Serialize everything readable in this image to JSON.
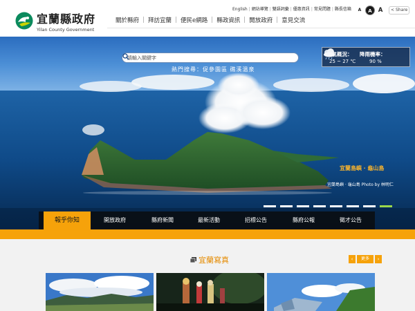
{
  "header": {
    "logo": {
      "name_cn": "宜蘭縣政府",
      "name_en": "Yilan County Government"
    },
    "utility_links": [
      {
        "label": "English"
      },
      {
        "label": "網站導覽"
      },
      {
        "label": "雙語詞彙"
      },
      {
        "label": "優惠資訊"
      },
      {
        "label": "常見問題"
      },
      {
        "label": "縣長信箱"
      }
    ],
    "font_sizes": [
      "A",
      "A",
      "A"
    ],
    "share_label": "Share",
    "main_nav": [
      {
        "label": "關於縣府"
      },
      {
        "label": "拜訪宜蘭"
      },
      {
        "label": "便民e網路"
      },
      {
        "label": "縣政資訊"
      },
      {
        "label": "開放政府"
      },
      {
        "label": "意見交流"
      }
    ]
  },
  "hero": {
    "search": {
      "placeholder": "請輸入關鍵字"
    },
    "hot_text": "熱門搜尋：促參園區 礁溪溫泉",
    "weather": {
      "overview_label": "天氣概況：",
      "temperature": "25 ~ 27 ℃",
      "rain_label": "降雨機率：",
      "rain_value": "90 %",
      "icon": "cloudy-rain-icon"
    },
    "caption_title": "宜蘭島嶼 ‧ 龜山島",
    "caption_credit": "宜蘭島嶼 ‧ 龜山島 Photo by 林明仁",
    "slide_count": 8,
    "active_slide": 8
  },
  "tabs": [
    {
      "label": "報乎你知",
      "active": true
    },
    {
      "label": "開放政府",
      "active": false
    },
    {
      "label": "縣府新聞",
      "active": false
    },
    {
      "label": "最新活動",
      "active": false
    },
    {
      "label": "招標公告",
      "active": false
    },
    {
      "label": "縣府公報",
      "active": false
    },
    {
      "label": "徵才公告",
      "active": false
    }
  ],
  "photos": {
    "title": "宜蘭寫真",
    "prev": "‹",
    "more": "更多",
    "next": "›"
  },
  "colors": {
    "accent": "#f6a20a",
    "title": "#e58b00",
    "nav_dark": "#0a0e14"
  }
}
